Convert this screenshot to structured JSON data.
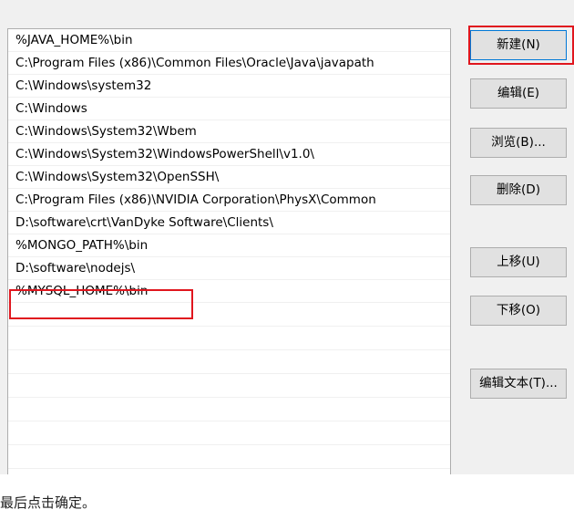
{
  "path_list": {
    "items": [
      "%JAVA_HOME%\\bin",
      "C:\\Program Files (x86)\\Common Files\\Oracle\\Java\\javapath",
      "C:\\Windows\\system32",
      "C:\\Windows",
      "C:\\Windows\\System32\\Wbem",
      "C:\\Windows\\System32\\WindowsPowerShell\\v1.0\\",
      "C:\\Windows\\System32\\OpenSSH\\",
      "C:\\Program Files (x86)\\NVIDIA Corporation\\PhysX\\Common",
      "D:\\software\\crt\\VanDyke Software\\Clients\\",
      "%MONGO_PATH%\\bin",
      "D:\\software\\nodejs\\",
      "%MYSQL_HOME%\\bin"
    ]
  },
  "buttons": {
    "new": "新建(N)",
    "edit": "编辑(E)",
    "browse": "浏览(B)...",
    "delete": "删除(D)",
    "move_up": "上移(U)",
    "move_down": "下移(O)",
    "edit_text": "编辑文本(T)..."
  },
  "caption": "最后点击确定。",
  "colors": {
    "highlight": "#e0161e",
    "accent": "#0078d7"
  }
}
